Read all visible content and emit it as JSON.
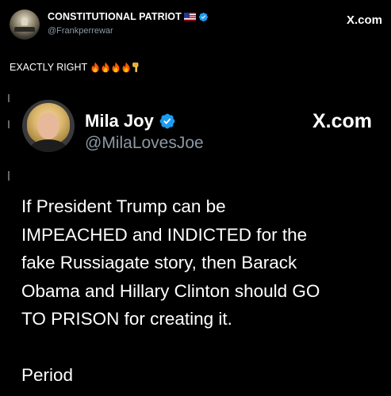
{
  "outer_post": {
    "display_name": "CONSTITUTIONAL PATRIOT",
    "handle": "@Frankperrewar",
    "site_label": "X.com",
    "text": "EXACTLY RIGHT",
    "emojis": [
      "fire-emoji",
      "fire-emoji",
      "fire-emoji",
      "fire-emoji",
      "point-down-emoji"
    ]
  },
  "quoted_post": {
    "display_name": "Mila Joy",
    "handle": "@MilaLovesJoe",
    "site_label": "X.com",
    "body_lines": [
      "If President Trump can be",
      "IMPEACHED and INDICTED for the",
      "fake Russiagate story, then Barack",
      "Obama and Hillary Clinton should GO",
      "TO PRISON for creating it."
    ],
    "closing": "Period"
  },
  "colors": {
    "background": "#000000",
    "text": "#ffffff",
    "muted": "#8b98a5",
    "verified_blue": "#1d9bf0"
  }
}
